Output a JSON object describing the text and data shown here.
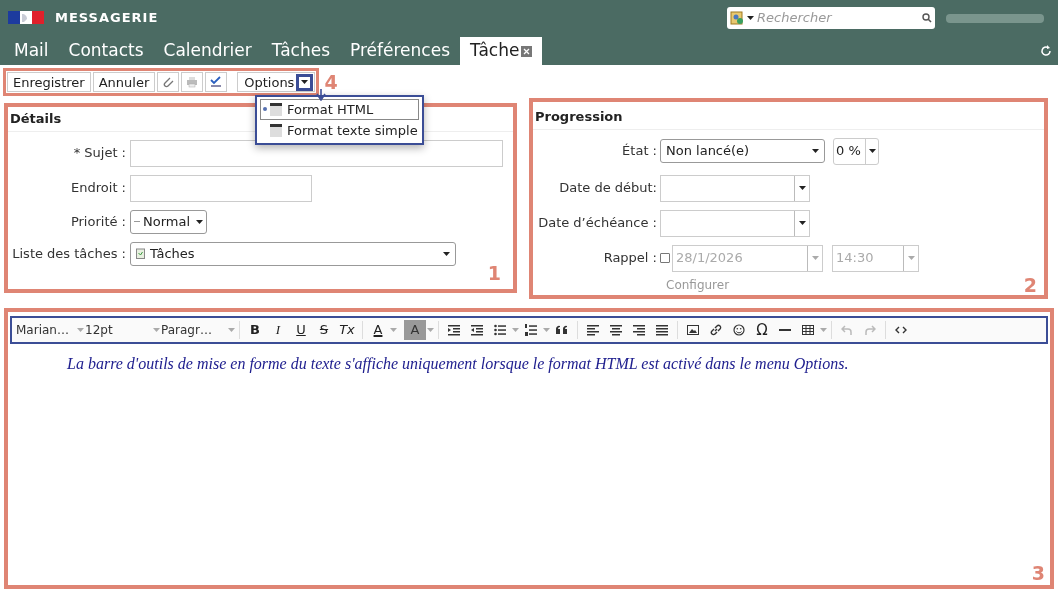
{
  "header": {
    "title": "MESSAGERIE",
    "search": {
      "placeholder": "Rechercher"
    }
  },
  "tabs": [
    {
      "label": "Mail",
      "selected": false
    },
    {
      "label": "Contacts",
      "selected": false
    },
    {
      "label": "Calendrier",
      "selected": false
    },
    {
      "label": "Tâches",
      "selected": false
    },
    {
      "label": "Préférences",
      "selected": false
    },
    {
      "label": "Tâche",
      "selected": true
    }
  ],
  "toolbar": {
    "buttons": [
      "Enregistrer",
      "Annuler"
    ],
    "options": "Options"
  },
  "options_menu": [
    {
      "label": "Format HTML",
      "selected": true
    },
    {
      "label": "Format texte simple",
      "selected": false
    }
  ],
  "details": {
    "title": "Détails",
    "subject_label": "* Sujet :",
    "location_label": "Endroit :",
    "priority_label": "Priorité :",
    "priority": "Normal",
    "list_label": "Liste des tâches :",
    "list": "Tâches"
  },
  "progression": {
    "title": "Progression",
    "state_label": "État :",
    "state": "Non lancé(e)",
    "percent": "0 %",
    "start_label": "Date de début:",
    "due_label": "Date d’échéance :",
    "reminder_label": "Rappel :",
    "reminder_checked": false,
    "reminder_date": "28/1/2026",
    "reminder_time": "14:30",
    "configure": "Configurer"
  },
  "editor": {
    "font": "Marian…",
    "size": "12pt",
    "block": "Paragr…",
    "glyphs": [
      "B",
      "I",
      "U",
      "S",
      "Tx",
      "A",
      "A",
      "Ω"
    ],
    "note": "La barre d'outils de mise en forme du texte s'affiche uniquement lorsque le format HTML est activé dans le menu Options."
  },
  "annotations": [
    "1",
    "2",
    "3",
    "4"
  ]
}
